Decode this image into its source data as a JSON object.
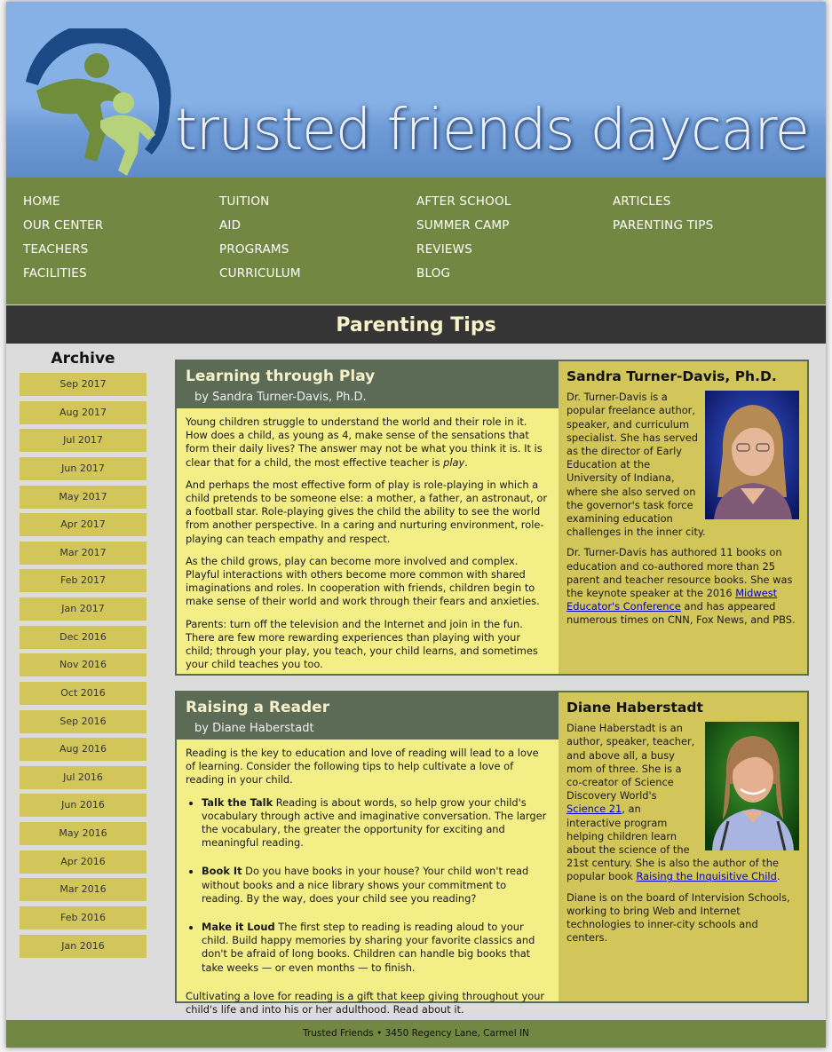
{
  "site": {
    "title": "trusted friends daycare"
  },
  "nav": {
    "col1": [
      "HOME",
      "OUR CENTER",
      "TEACHERS",
      "FACILITIES"
    ],
    "col2": [
      "TUITION",
      "AID",
      "PROGRAMS",
      "CURRICULUM"
    ],
    "col3": [
      "AFTER SCHOOL",
      "SUMMER CAMP",
      "REVIEWS",
      "BLOG"
    ],
    "col4": [
      "ARTICLES",
      "PARENTING TIPS"
    ]
  },
  "banner": "Parenting Tips",
  "archive": {
    "title": "Archive",
    "months": [
      "Sep 2017",
      "Aug 2017",
      "Jul 2017",
      "Jun 2017",
      "May 2017",
      "Apr 2017",
      "Mar 2017",
      "Feb 2017",
      "Jan 2017",
      "Dec 2016",
      "Nov 2016",
      "Oct 2016",
      "Sep 2016",
      "Aug 2016",
      "Jul 2016",
      "Jun 2016",
      "May 2016",
      "Apr 2016",
      "Mar 2016",
      "Feb 2016",
      "Jan 2016"
    ]
  },
  "article1": {
    "title": "Learning through Play",
    "byline": "by Sandra Turner-Davis, Ph.D.",
    "p1a": "Young children struggle to understand the world and their role in it. How does a child, as young as 4, make sense of the sensations that form their daily lives? The answer may not be what you think it is. It is clear that for a child, the most effective teacher is ",
    "p1b": "play",
    "p1c": ".",
    "p2": "And perhaps the most effective form of play is role-playing in which a child pretends to be someone else: a mother, a father, an astronaut, or a football star. Role-playing gives the child the ability to see the world from another perspective. In a caring and nurturing environment, role-playing can teach empathy and respect.",
    "p3": "As the child grows, play can become more involved and complex. Playful interactions with others become more common with shared imaginations and roles. In cooperation with friends, children begin to make sense of their world and work through their fears and anxieties.",
    "p4": "Parents: turn off the television and the Internet and join in the fun. There are few more rewarding experiences than playing with your child; through your play, you teach, your child learns, and sometimes your child teaches you too.",
    "author": {
      "name": "Sandra Turner-Davis, Ph.D.",
      "bio1": "Dr. Turner-Davis is a popular freelance author, speaker, and curriculum specialist. She has served as the director of Early Education at the University of Indiana, where she also served on the governor's task force examining education challenges in the inner city.",
      "bio2a": "Dr. Turner-Davis has authored 11 books on education and co-authored more than 25 parent and teacher resource books. She was the keynote speaker at the 2016 ",
      "bio2link": "Midwest Educator's Conference",
      "bio2b": " and has appeared numerous times on CNN, Fox News, and PBS."
    }
  },
  "article2": {
    "title": "Raising a Reader",
    "byline": "by Diane Haberstadt",
    "intro": "Reading is the key to education and love of reading will lead to a love of learning. Consider the following tips to help cultivate a love of reading in your child.",
    "tips": [
      {
        "head": "Talk the Talk",
        "text": " Reading is about words, so help grow your child's vocabulary through active and imaginative conversation. The larger the vocabulary, the greater the opportunity for exciting and meaningful reading."
      },
      {
        "head": "Book It",
        "text": " Do you have books in your house? Your child won't read without books and a nice library shows your commitment to reading. By the way, does your child see you reading?"
      },
      {
        "head": "Make it Loud",
        "text": " The first step to reading is reading aloud to your child. Build happy memories by sharing your favorite classics and don't be afraid of long books. Children can handle big books that take weeks — or even months — to finish."
      }
    ],
    "outro": "Cultivating a love for reading is a gift that keep giving throughout your child's life and into his or her adulthood. Read about it.",
    "author": {
      "name": "Diane Haberstadt",
      "bio1a": "Diane Haberstadt is an author, speaker, teacher, and above all, a busy mom of three. She is a co-creator of Science Discovery World's ",
      "bio1link": "Science 21",
      "bio1b": ", an interactive program helping children learn about the science of the 21st century. She is also the author of the popular book ",
      "bio1link2": "Raising the Inquisitive Child",
      "bio1c": ".",
      "bio2": "Diane is on the board of Intervision Schools, working to bring Web and Internet technologies to inner-city schools and centers."
    }
  },
  "footer": "Trusted Friends • 3450 Regency Lane, Carmel IN",
  "colors": {
    "sky": "#86b1e6",
    "nav_green": "#728842",
    "banner_dark": "#353535",
    "article_head": "#5c6b56",
    "article_body": "#f3ee85",
    "sidebar_gold": "#d2c65a"
  }
}
